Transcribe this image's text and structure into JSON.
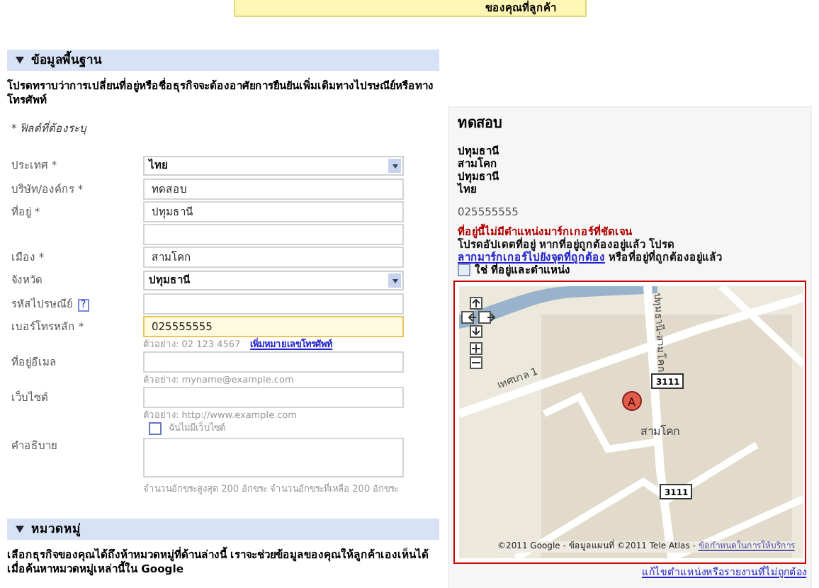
{
  "banner": {
    "text": "ของคุณที่ลูกค้า"
  },
  "basic_info": {
    "title": "ข้อมูลพื้นฐาน",
    "expanded": true,
    "notice": "โปรดทราบว่าการเปลี่ยนที่อยู่หรือชื่อธุรกิจจะต้องอาศัยการยืนยันเพิ่มเติมทางไปรษณีย์หรือทางโทรศัพท์",
    "required_note": "* ฟิลด์ที่ต้องระบุ",
    "fields": [
      {
        "kind": "select",
        "label": "ประเทศ *",
        "value": "ไทย"
      },
      {
        "kind": "text",
        "label": "บริษัท/องค์กร *",
        "value": "ทดสอบ"
      },
      {
        "kind": "text",
        "label": "ที่อยู่ *",
        "value": "ปทุมธานี"
      },
      {
        "kind": "text"
      },
      {
        "kind": "text",
        "label": "เมือง *",
        "value": "สามโคก"
      },
      {
        "kind": "select",
        "label": "จังหวัด",
        "value": "ปทุมธานี"
      },
      {
        "kind": "text",
        "label": "รหัสไปรษณีย์",
        "help": "?"
      },
      {
        "kind": "text",
        "label": "เบอร์โทรหลัก *",
        "value": "025555555",
        "focused": true,
        "hint": "ตัวอย่าง: 02 123 4567",
        "hint_link": "เพิ่มหมายเลขโทรศัพท์"
      },
      {
        "kind": "text",
        "label": "ที่อยู่อีเมล",
        "hint": "ตัวอย่าง: myname@example.com"
      },
      {
        "kind": "text",
        "label": "เว็บไซต์",
        "hint": "ตัวอย่าง: http://www.example.com",
        "checkbox": {
          "label": "ฉันไม่มีเว็บไซต์",
          "checked": false
        }
      },
      {
        "kind": "textarea",
        "label": "คำอธิบาย",
        "hint": "จำนวนอักขระสูงสุด 200 อักขระ จำนวนอักขระที่เหลือ 200 อักขระ"
      }
    ]
  },
  "categories": {
    "title": "หมวดหมู่",
    "expanded": true,
    "notice": "เลือกธุรกิจของคุณได้ถึงห้าหมวดหมู่ที่ด้านล่างนี้ เราจะช่วยข้อมูลของคุณให้ลูกค้าเองเห็นได้เมื่อค้นหาหมวดหมู่เหล่านี้ใน Google"
  },
  "preview": {
    "name": "ทดสอบ",
    "address_lines": [
      "ปทุมธานี",
      "สามโคก",
      "ปทุมธานี",
      "ไทย"
    ],
    "phone": "025555555",
    "warning": "ที่อยู่นี้ไม่มีตำแหน่งมาร์กเกอร์ที่ชัดเจน",
    "instruction": "โปรดอัปเดตที่อยู่ หากที่อยู่ถูกต้องอยู่แล้ว โปรด",
    "instruction_link": "ลากมาร์กเกอร์ไปยังจุดที่ถูกต้อง",
    "instruction_end": "หรือที่อยู่ที่ถูกต้องอยู่แล้ว",
    "confirm": {
      "label": "ใช่ ที่อยู่และตำแหน่ง",
      "checked": false
    },
    "map": {
      "road_labels": [
        "เทศบาล 1",
        "ปทุมธานี-สามโคก"
      ],
      "route_shields": [
        "3111",
        "3111"
      ],
      "place_label": "สามโคก",
      "marker": "A",
      "attribution": "©2011 Google - ข้อมูลแผนที่ ©2011 Tele Atlas - ",
      "terms_link": "ข้อกำหนดในการให้บริการ"
    },
    "report_link": "แก้ไขตำแหน่งหรือรายงานที่ไม่ถูกต้อง"
  }
}
